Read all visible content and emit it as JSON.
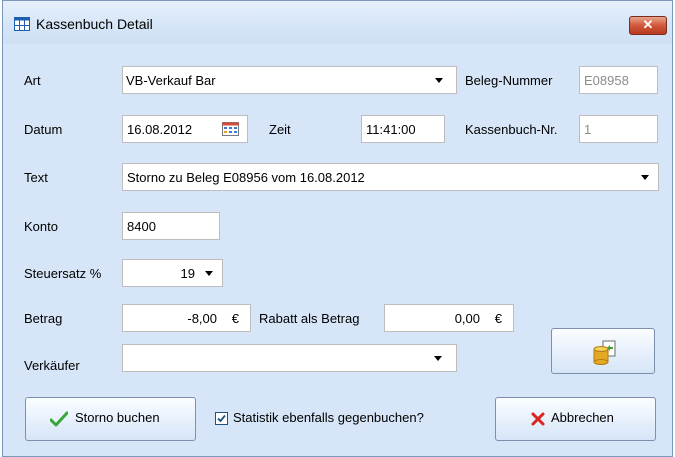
{
  "window": {
    "title": "Kassenbuch Detail",
    "close_label": "✕"
  },
  "form": {
    "art": {
      "label": "Art",
      "value": "VB-Verkauf Bar"
    },
    "beleg_nummer": {
      "label": "Beleg-Nummer",
      "value": "E08958"
    },
    "datum": {
      "label": "Datum",
      "value": "16.08.2012"
    },
    "zeit": {
      "label": "Zeit",
      "value": "11:41:00"
    },
    "kassenbuch_nr": {
      "label": "Kassenbuch-Nr.",
      "value": "1"
    },
    "text": {
      "label": "Text",
      "value": "Storno zu Beleg E08956 vom 16.08.2012"
    },
    "konto": {
      "label": "Konto",
      "value": "8400"
    },
    "steuersatz": {
      "label": "Steuersatz %",
      "value": "19"
    },
    "betrag": {
      "label": "Betrag",
      "value": "-8,00",
      "currency": "€"
    },
    "rabatt": {
      "label": "Rabatt als Betrag",
      "value": "0,00",
      "currency": "€"
    },
    "verkaeufer": {
      "label": "Verkäufer",
      "value": ""
    }
  },
  "actions": {
    "storno_label": "Storno buchen",
    "statistik_label": "Statistik ebenfalls gegenbuchen?",
    "statistik_checked": true,
    "abbrechen_label": "Abbrechen"
  },
  "icons": {
    "title": "table-icon",
    "calendar": "calendar-icon",
    "database": "database-export-icon",
    "check": "checkmark-icon",
    "cancel": "red-x-icon"
  }
}
